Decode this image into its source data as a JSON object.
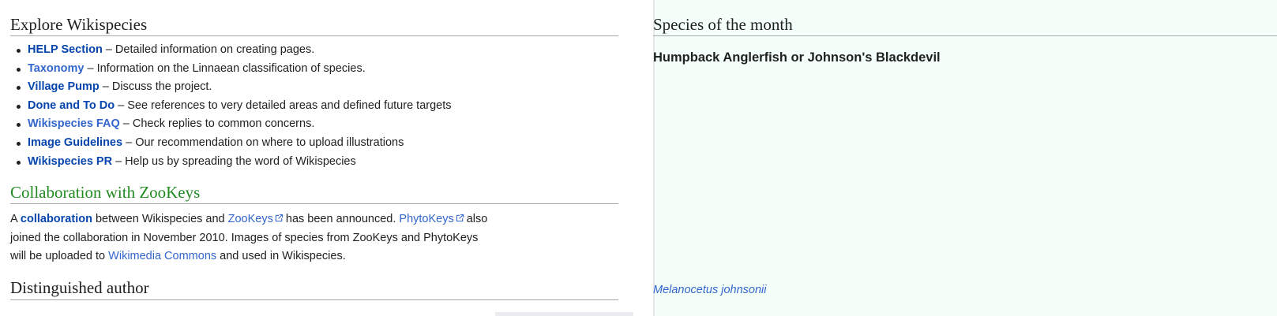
{
  "explore": {
    "heading": "Explore Wikispecies",
    "items": [
      {
        "link": "HELP Section",
        "desc": "– Detailed information on creating pages."
      },
      {
        "link": "Taxonomy",
        "desc": "– Information on the Linnaean classification of species."
      },
      {
        "link": "Village Pump",
        "desc": "– Discuss the project."
      },
      {
        "link": "Done and To Do",
        "desc": "– See references to very detailed areas and defined future targets"
      },
      {
        "link": "Wikispecies FAQ",
        "desc": "– Check replies to common concerns."
      },
      {
        "link": "Image Guidelines",
        "desc": "– Our recommendation on where to upload illustrations"
      },
      {
        "link": "Wikispecies PR",
        "desc": "– Help us by spreading the word of Wikispecies"
      }
    ]
  },
  "collaboration": {
    "heading": "Collaboration with ZooKeys",
    "text_a": "A",
    "link_collaboration": "collaboration",
    "text_b": "between Wikispecies and",
    "link_zookeys": "ZooKeys",
    "text_c": "has been announced.",
    "link_phytokeys": "PhytoKeys",
    "text_d": "also",
    "line2": "joined the collaboration in November 2010. Images of species from ZooKeys and PhytoKeys",
    "text_e": "will be uploaded to",
    "link_commons": "Wikimedia Commons",
    "text_f": "and used in Wikispecies."
  },
  "author": {
    "heading": "Distinguished author"
  },
  "species": {
    "heading": "Species of the month",
    "title": "Humpback Anglerfish or Johnson's Blackdevil",
    "caption": "Melanocetus johnsonii"
  },
  "colors": {
    "link": "#3366cc",
    "link_visited": "#0645ad",
    "green_heading": "#228b22",
    "right_panel_bg": "#f5fffa"
  }
}
